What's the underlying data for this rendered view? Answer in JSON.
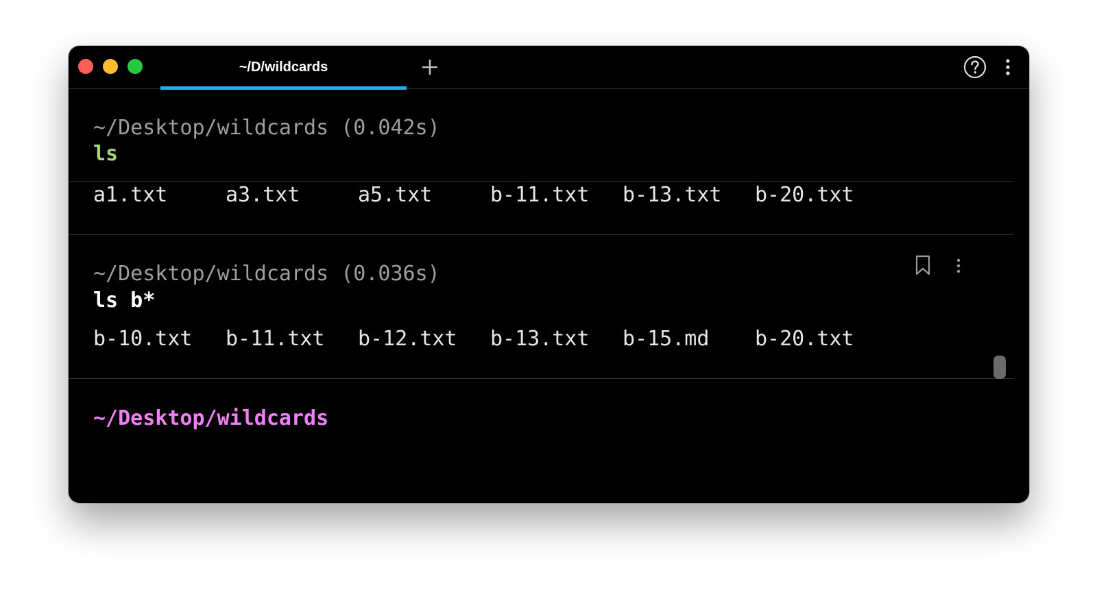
{
  "window": {
    "traffic_lights": {
      "close_color": "#ff5f57",
      "minimize_color": "#febc2e",
      "zoom_color": "#28c840"
    },
    "active_tab": {
      "title": "~/D/wildcards",
      "underline_color": "#1fb0e8"
    },
    "new_tab_icon": "plus-icon",
    "help_icon": "question-circle-icon",
    "menu_icon": "vertical-dots-icon"
  },
  "blocks": [
    {
      "prompt": "~/Desktop/wildcards (0.042s)",
      "command": "ls",
      "command_color": "#a3d977",
      "output": [
        "a1.txt",
        "a3.txt",
        "a5.txt",
        "b-11.txt",
        "b-13.txt",
        "b-20.txt"
      ]
    },
    {
      "prompt": "~/Desktop/wildcards (0.036s)",
      "command": "ls b*",
      "command_color": "#ffffff",
      "output": [
        "b-10.txt",
        "b-11.txt",
        "b-12.txt",
        "b-13.txt",
        "b-15.md",
        "b-20.txt"
      ],
      "bookmark_icon": "bookmark-icon",
      "menu_icon": "vertical-dots-icon"
    }
  ],
  "current_prompt": {
    "text": "~/Desktop/wildcards",
    "color": "#f07ef5"
  },
  "scrollbar_color": "#6b6b6b"
}
